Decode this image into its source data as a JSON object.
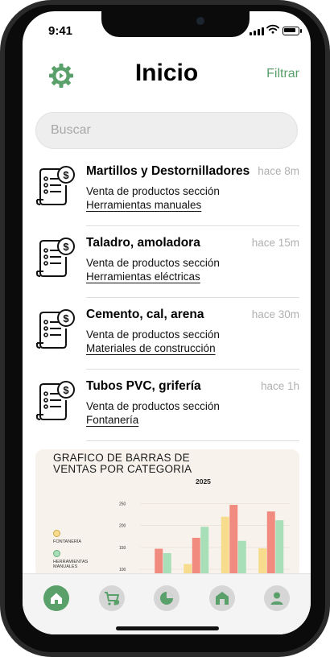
{
  "status_bar": {
    "time": "9:41"
  },
  "header": {
    "title": "Inicio",
    "filter_label": "Filtrar",
    "settings_icon": "gear-icon"
  },
  "search": {
    "placeholder": "Buscar",
    "value": ""
  },
  "colors": {
    "accent": "#5aa06a",
    "bar_yellow": "#f6dc8c",
    "bar_red": "#f28b7f",
    "bar_green": "#a8dfb8"
  },
  "items": [
    {
      "title": "Martillos y Destornilladores",
      "time": "hace 8m",
      "description": "Venta de productos sección",
      "category": "Herramientas manuales",
      "icon": "invoice-dollar-icon"
    },
    {
      "title": "Taladro, amoladora",
      "time": "hace 15m",
      "description": "Venta de productos sección",
      "category": "Herramientas eléctricas",
      "icon": "invoice-dollar-icon"
    },
    {
      "title": "Cemento, cal, arena",
      "time": "hace 30m",
      "description": "Venta de productos sección",
      "category": "Materiales de construcción",
      "icon": "invoice-dollar-icon"
    },
    {
      "title": "Tubos PVC, grifería",
      "time": "hace 1h",
      "description": "Venta de productos sección",
      "category": "Fontanería",
      "icon": "invoice-dollar-icon"
    }
  ],
  "chart_card": {
    "title": "GRAFICO DE BARRAS DE VENTAS POR CATEGORIA",
    "year": "2025",
    "legend": [
      "FONTANERÍA",
      "HERRAMIENTAS MANUALES"
    ]
  },
  "chart_data": {
    "type": "bar",
    "title": "GRAFICO DE BARRAS DE VENTAS POR CATEGORIA",
    "subtitle": "2025",
    "yticks": [
      100,
      150,
      200,
      250
    ],
    "ylim": [
      80,
      260
    ],
    "categories": [
      "",
      "",
      "",
      ""
    ],
    "series": [
      {
        "color": "#f6dc8c",
        "values": [
          80,
          112,
          220,
          148
        ]
      },
      {
        "color": "#f28b7f",
        "values": [
          147,
          172,
          247,
          232
        ]
      },
      {
        "color": "#a8dfb8",
        "values": [
          137,
          197,
          165,
          212
        ]
      }
    ],
    "grid": true,
    "legend": "left"
  },
  "tabs": [
    {
      "icon": "home-icon",
      "active": true
    },
    {
      "icon": "cart-icon",
      "active": false
    },
    {
      "icon": "pie-chart-icon",
      "active": false
    },
    {
      "icon": "store-icon",
      "active": false
    },
    {
      "icon": "user-icon",
      "active": false
    }
  ]
}
